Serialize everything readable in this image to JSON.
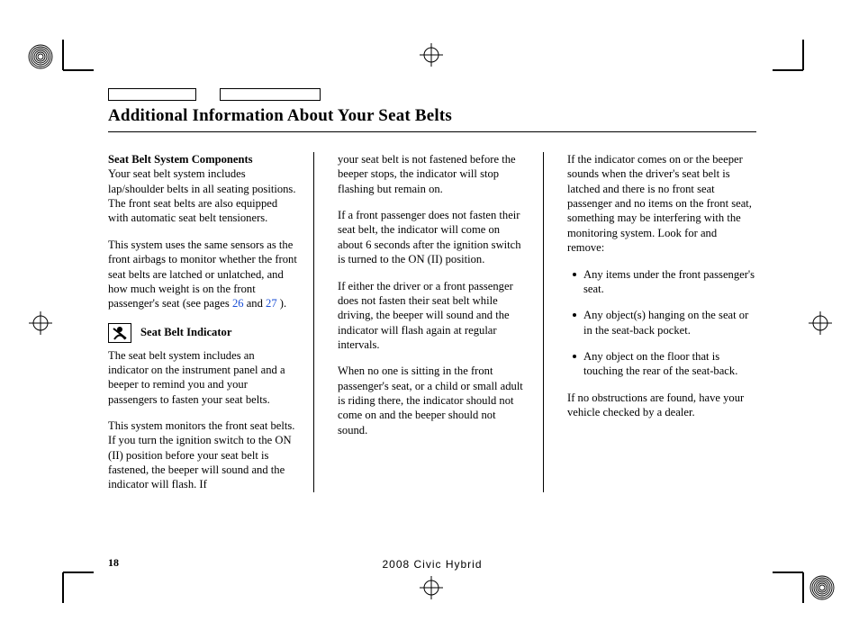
{
  "title": "Additional Information About Your Seat Belts",
  "page_number": "18",
  "model_line": "2008  Civic  Hybrid",
  "col1": {
    "h1": "Seat Belt System Components",
    "p1a": "Your seat belt system includes lap/shoulder belts in all seating positions. The front seat belts are also equipped with automatic seat belt tensioners.",
    "p2a": "This system uses the same sensors as the front airbags to monitor whether the front seat belts are latched or unlatched, and how much weight is on the front passenger's seat (see pages ",
    "link1": "26",
    "p2b": " and ",
    "link2": "27",
    "p2c": " ).",
    "h2": "Seat Belt Indicator",
    "p3": "The seat belt system includes an indicator on the instrument panel and a beeper to remind you and your passengers to fasten your seat belts.",
    "p4": "This system monitors the front seat belts. If you turn the ignition switch to the ON (II) position before your seat belt is fastened, the beeper will sound and the indicator will flash. If"
  },
  "col2": {
    "p1": "your seat belt is not fastened before the beeper stops, the indicator will stop flashing but remain on.",
    "p2": "If a front passenger does not fasten their seat belt, the indicator will come on about 6 seconds after the ignition switch is turned to the ON (II) position.",
    "p3": "If either the driver or a front passenger does not fasten their seat belt while driving, the beeper will sound and the indicator will flash again at regular intervals.",
    "p4": "When no one is sitting in the front passenger's seat, or a child or small adult is riding there, the indicator should not come on and the beeper should not sound."
  },
  "col3": {
    "p1": "If the indicator comes on or the beeper sounds when the driver's seat belt is latched and there is no front seat passenger and no items on the front seat, something may be interfering with the monitoring system. Look for and remove:",
    "b1": "Any items under the front passenger's seat.",
    "b2": "Any object(s) hanging on the seat or in the seat-back pocket.",
    "b3": "Any object on the floor that is touching the rear of the seat-back.",
    "p2": "If no obstructions are found, have your vehicle checked by a dealer."
  }
}
